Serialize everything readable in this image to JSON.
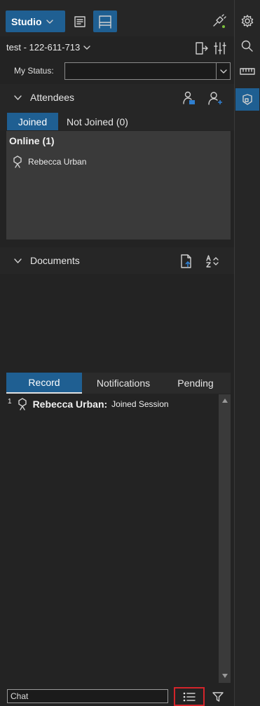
{
  "toolbar": {
    "studio_label": "Studio"
  },
  "session": {
    "id_label": "test - 122-611-713"
  },
  "status": {
    "label": "My Status:",
    "value": ""
  },
  "attendees": {
    "title": "Attendees",
    "tabs": [
      {
        "label": "Joined",
        "active": true
      },
      {
        "label": "Not Joined (0)",
        "active": false
      }
    ],
    "online_heading": "Online (1)",
    "online": [
      {
        "name": "Rebecca Urban"
      }
    ]
  },
  "documents": {
    "title": "Documents"
  },
  "record": {
    "tabs": [
      {
        "label": "Record",
        "active": true
      },
      {
        "label": "Notifications",
        "active": false
      },
      {
        "label": "Pending",
        "active": false
      }
    ],
    "entries": [
      {
        "index": "1",
        "name": "Rebecca Urban:",
        "event": "Joined Session"
      }
    ]
  },
  "chat": {
    "placeholder": "Chat"
  },
  "colors": {
    "accent": "#1f5f92",
    "highlight_border": "#d4242a",
    "panel": "#3a3a3a",
    "background": "#232323"
  },
  "icons": {
    "doc": "document-icon",
    "board": "whiteboard-icon",
    "plug": "plug-icon",
    "settings": "gear-icon",
    "search": "search-icon",
    "ruler": "ruler-icon",
    "shape": "shape-icon",
    "exit": "exit-icon",
    "mixer": "mixer-icon",
    "user": "user-icon",
    "list": "list-icon",
    "filter": "filter-icon"
  }
}
